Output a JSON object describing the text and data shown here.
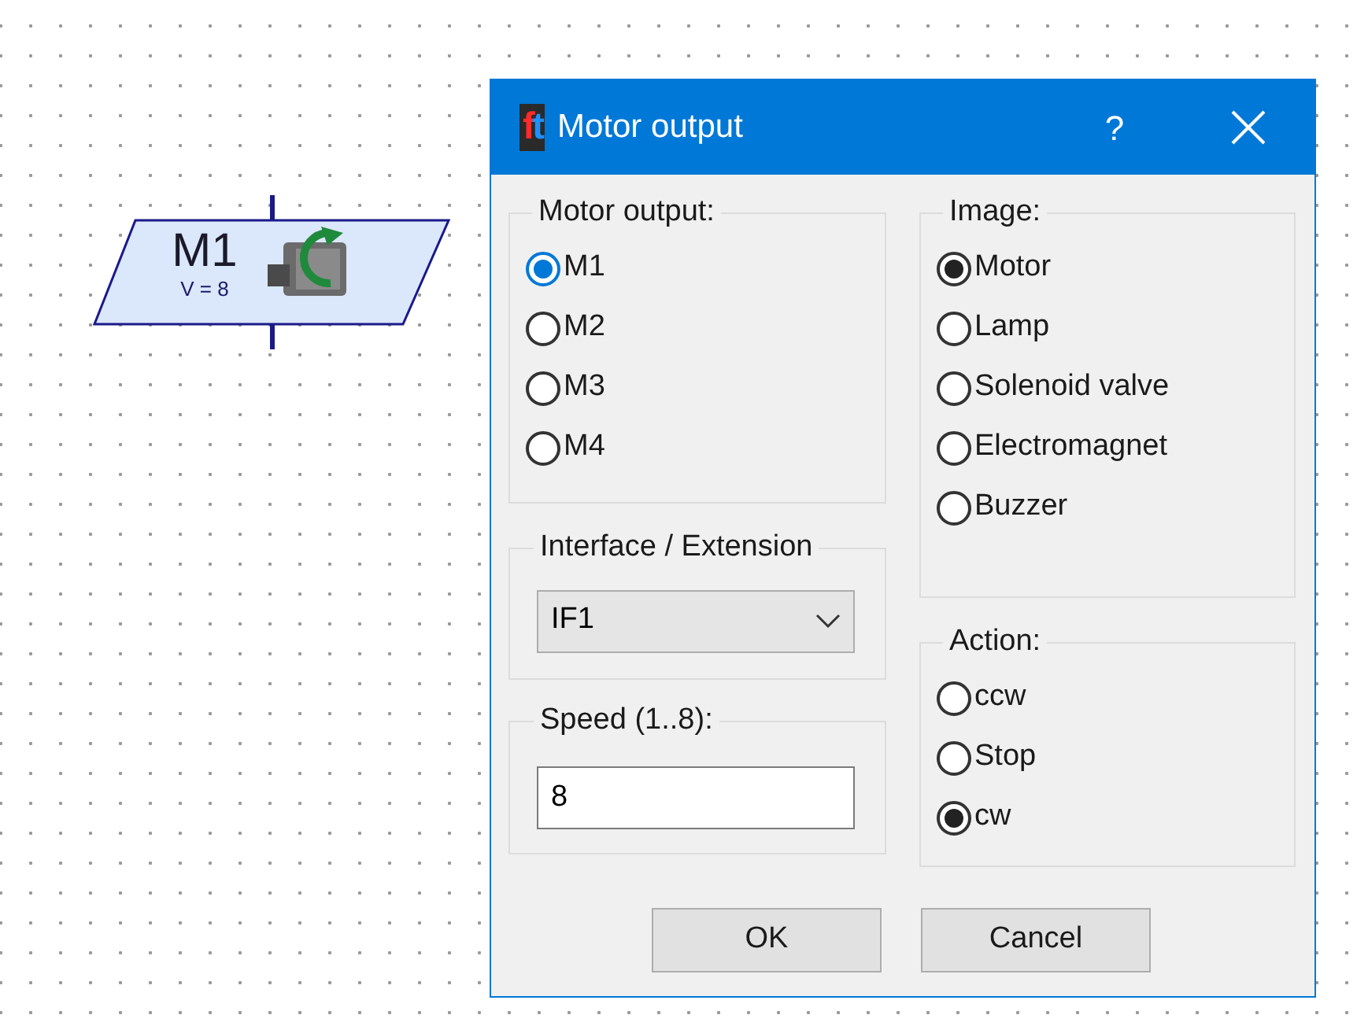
{
  "block": {
    "label": "M1",
    "subtitle": "V = 8"
  },
  "window": {
    "logo": "ft",
    "title": "Motor output",
    "help": "?"
  },
  "motor_output": {
    "title": "Motor output:",
    "focused": true,
    "options": [
      {
        "label": "M1",
        "selected": true
      },
      {
        "label": "M2",
        "selected": false
      },
      {
        "label": "M3",
        "selected": false
      },
      {
        "label": "M4",
        "selected": false
      }
    ]
  },
  "interface": {
    "title": "Interface / Extension",
    "value": "IF1"
  },
  "speed": {
    "title": "Speed (1..8):",
    "value": "8"
  },
  "image": {
    "title": "Image:",
    "focused": false,
    "options": [
      {
        "label": "Motor",
        "selected": true
      },
      {
        "label": "Lamp",
        "selected": false
      },
      {
        "label": "Solenoid valve",
        "selected": false
      },
      {
        "label": "Electromagnet",
        "selected": false
      },
      {
        "label": "Buzzer",
        "selected": false
      }
    ]
  },
  "action": {
    "title": "Action:",
    "focused": false,
    "options": [
      {
        "label": "ccw",
        "selected": false
      },
      {
        "label": "Stop",
        "selected": false
      },
      {
        "label": "cw",
        "selected": true
      }
    ]
  },
  "buttons": [
    "OK",
    "Cancel"
  ]
}
